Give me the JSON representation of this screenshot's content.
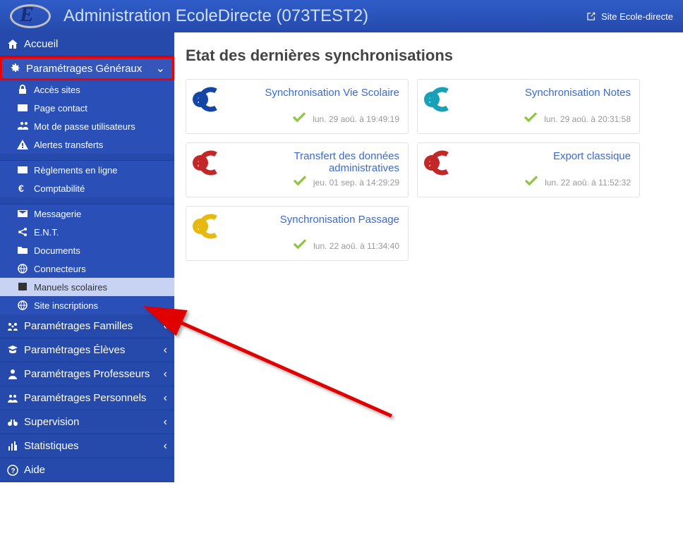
{
  "header": {
    "title": "Administration EcoleDirecte (073TEST2)",
    "site_link": "Site Ecole-directe"
  },
  "sidebar": {
    "accueil": "Accueil",
    "param_gen": "Paramétrages Généraux",
    "sub": {
      "acces_sites": "Accès sites",
      "page_contact": "Page contact",
      "mdp_util": "Mot de passe utilisateurs",
      "alertes": "Alertes transferts",
      "reglements": "Règlements en ligne",
      "compta": "Comptabilité",
      "messagerie": "Messagerie",
      "ent": "E.N.T.",
      "documents": "Documents",
      "connecteurs": "Connecteurs",
      "manuels": "Manuels scolaires",
      "site_inscr": "Site inscriptions"
    },
    "familles": "Paramétrages Familles",
    "eleves": "Paramétrages Élèves",
    "profs": "Paramétrages Professeurs",
    "personnels": "Paramétrages Personnels",
    "supervision": "Supervision",
    "stats": "Statistiques",
    "aide": "Aide"
  },
  "main": {
    "heading": "Etat des dernières synchronisations",
    "cards": [
      {
        "title": "Synchronisation Vie Scolaire",
        "date": "lun. 29 aoû. à 19:49:19",
        "color": "#1445a5"
      },
      {
        "title": "Synchronisation Notes",
        "date": "lun. 29 aoû. à 20:31:58",
        "color": "#17a0b8"
      },
      {
        "title": "Transfert des données administratives",
        "date": "jeu. 01 sep. à 14:29:29",
        "color": "#c22828"
      },
      {
        "title": "Export classique",
        "date": "lun. 22 aoû. à 11:52:32",
        "color": "#c22828"
      },
      {
        "title": "Synchronisation Passage",
        "date": "lun. 22 aoû. à 11:34:40",
        "color": "#e7b80f"
      }
    ]
  }
}
